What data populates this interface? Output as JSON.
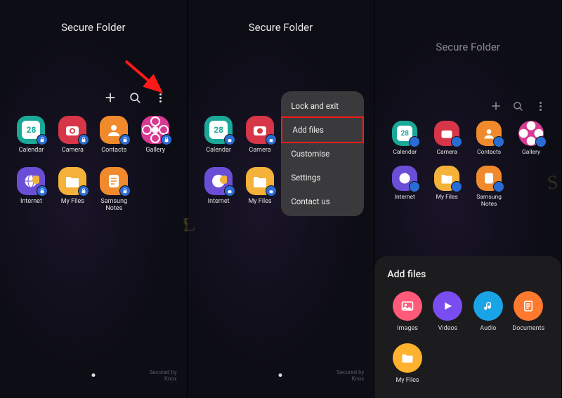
{
  "title": "Secure Folder",
  "toolbar": {
    "add": "+",
    "search": "search",
    "more": "more"
  },
  "apps": [
    {
      "name": "Calendar",
      "label": "Calendar",
      "day": "28",
      "bg": "bg-teal"
    },
    {
      "name": "Camera",
      "label": "Camera",
      "bg": "bg-red"
    },
    {
      "name": "Contacts",
      "label": "Contacts",
      "bg": "bg-orange"
    },
    {
      "name": "Gallery",
      "label": "Gallery",
      "bg": "bg-pink"
    },
    {
      "name": "Internet",
      "label": "Internet",
      "bg": "bg-purple"
    },
    {
      "name": "My Files",
      "label": "My Files",
      "bg": "bg-yellow"
    },
    {
      "name": "Samsung Notes",
      "label": "Samsung\nNotes",
      "bg": "bg-orange"
    }
  ],
  "secured": "Secured by\nKnox",
  "menu": {
    "items": [
      {
        "label": "Lock and exit"
      },
      {
        "label": "Add files",
        "highlight": true
      },
      {
        "label": "Customise"
      },
      {
        "label": "Settings"
      },
      {
        "label": "Contact us"
      }
    ]
  },
  "sheet": {
    "title": "Add files",
    "items": [
      {
        "label": "Images",
        "icon": "image",
        "color": "c-pink"
      },
      {
        "label": "Videos",
        "icon": "play",
        "color": "c-purple"
      },
      {
        "label": "Audio",
        "icon": "note",
        "color": "c-blue"
      },
      {
        "label": "Documents",
        "icon": "doc",
        "color": "c-orange"
      },
      {
        "label": "My Files",
        "icon": "folder",
        "color": "c-yellow"
      }
    ]
  }
}
